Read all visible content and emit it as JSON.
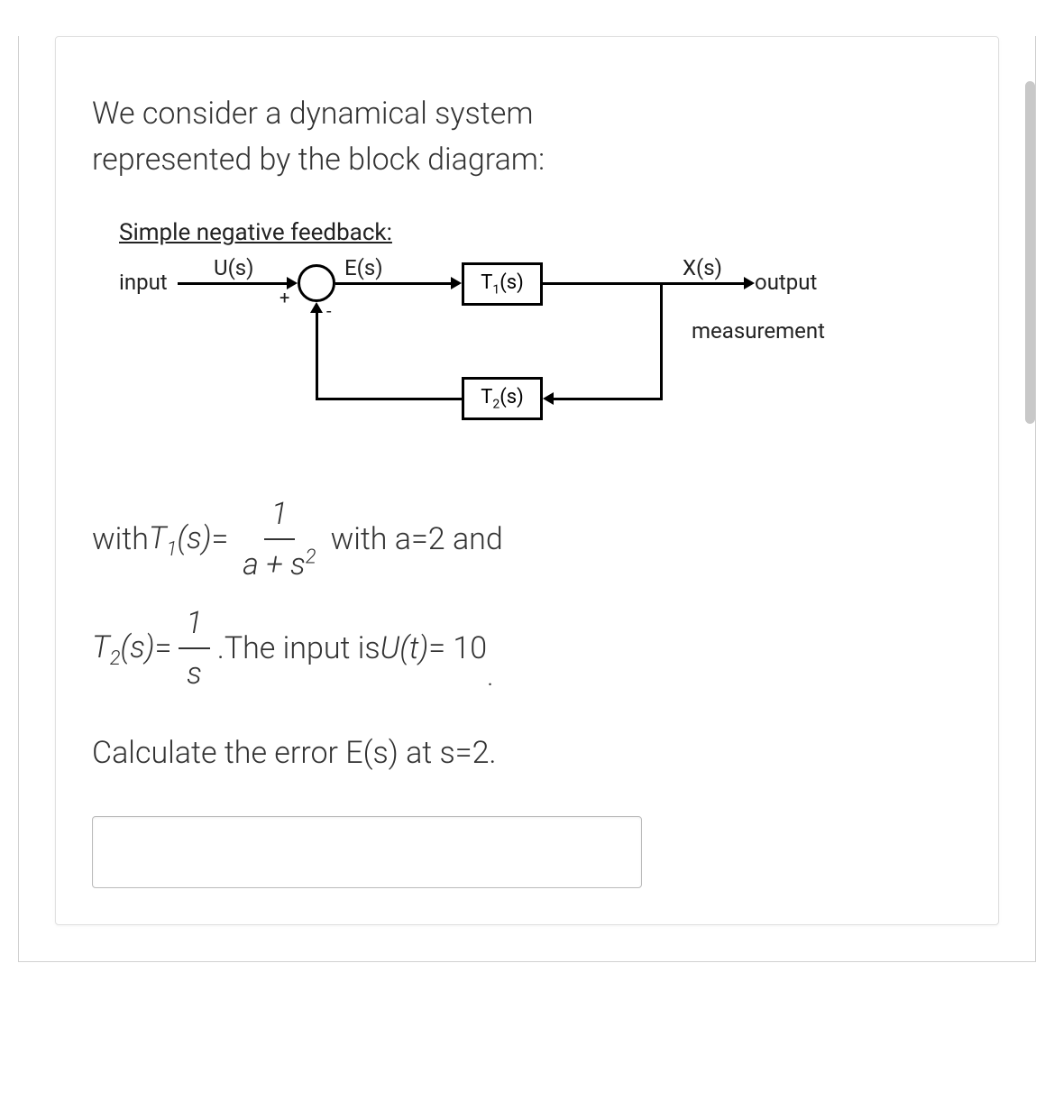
{
  "intro": {
    "line1": "We consider a dynamical system",
    "line2": "represented by the block diagram:"
  },
  "diagram": {
    "title": "Simple negative feedback:",
    "labels": {
      "input": "input",
      "U": "U(s)",
      "E": "E(s)",
      "T1": "T",
      "T1_sub": "1",
      "T1_suffix": "(s)",
      "T2": "T",
      "T2_sub": "2",
      "T2_suffix": "(s)",
      "X": "X(s)",
      "output": "output",
      "measurement": "measurement",
      "plus": "+",
      "minus": "-"
    }
  },
  "equations": {
    "with": "with ",
    "T1_sym": "T",
    "T1_sub": "1",
    "s_paren": "(s)",
    "eq": " = ",
    "frac1_num": "1",
    "frac1_den_a": "a",
    "frac1_den_plus": " + ",
    "frac1_den_s": "s",
    "frac1_den_exp": "2",
    "with_a": " with a=2 and",
    "T2_sym": "T",
    "T2_sub": "2",
    "frac2_num": "1",
    "frac2_den": "s",
    "period": ". ",
    "input_is": "The input is ",
    "Ut": "U(t)",
    "eq_ten": " = 10",
    "final_period": "."
  },
  "question": "Calculate the error E(s) at s=2.",
  "input": {
    "placeholder": ""
  }
}
